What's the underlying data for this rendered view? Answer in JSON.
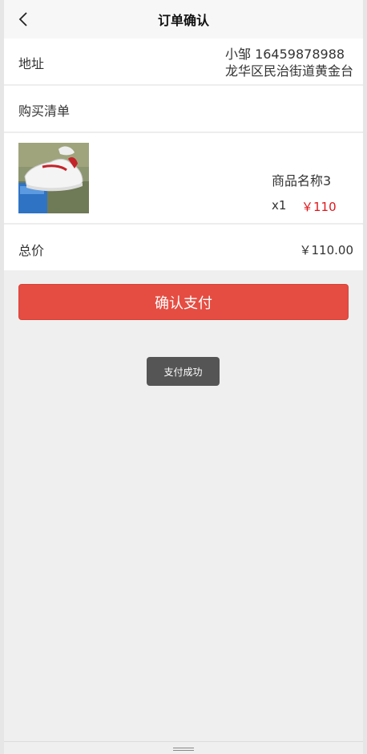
{
  "nav": {
    "title": "订单确认",
    "back_icon": "chevron-left-icon"
  },
  "address": {
    "label": "地址",
    "contact": "小邹 16459878988",
    "detail": "龙华区民治街道黄金台"
  },
  "shopping_list": {
    "label": "购买清单"
  },
  "item": {
    "image": "white-sneaker-product-image",
    "name": "商品名称3",
    "quantity": "x1",
    "price": "￥110"
  },
  "total": {
    "label": "总价",
    "value": "￥110.00"
  },
  "pay_button": {
    "label": "确认支付"
  },
  "toast": {
    "text": "支付成功"
  },
  "colors": {
    "accent": "#e54d42",
    "price": "#e0161b",
    "background": "#efefef"
  }
}
